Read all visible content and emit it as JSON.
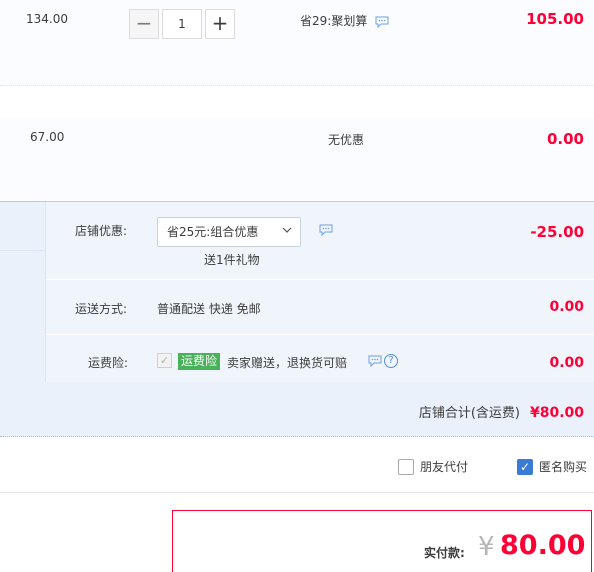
{
  "items": [
    {
      "unit_price": "134.00",
      "quantity": "1",
      "promo": "省29:聚划算",
      "subtotal": "105.00"
    },
    {
      "unit_price": "67.00",
      "promo": "无优惠",
      "subtotal": "0.00"
    }
  ],
  "stepper": {
    "minus": "−",
    "plus": "+"
  },
  "shop": {
    "coupon_label": "店铺优惠:",
    "coupon_selected": "省25元:组合优惠",
    "gift_text": "送1件礼物",
    "coupon_amount": "-25.00",
    "shipping_label": "运送方式:",
    "shipping_text": "普通配送 快递 免邮",
    "shipping_amount": "0.00",
    "insurance_label": "运费险:",
    "insurance_badge": "运费险",
    "insurance_text": "卖家赠送，退换货可赔",
    "insurance_amount": "0.00",
    "total_label": "店铺合计(含运费)",
    "total_value": "¥80.00"
  },
  "options": {
    "friend_pay_label": "朋友代付",
    "friend_pay_checked": false,
    "anonymous_label": "匿名购买",
    "anonymous_checked": true
  },
  "payment": {
    "label": "实付款:",
    "currency": "¥",
    "amount": "80.00"
  },
  "colors": {
    "price_red": "#ff0036",
    "panel_bg": "#eaf1fb",
    "badge_green": "#48b25a",
    "check_blue": "#3a7bd5"
  },
  "icons": {
    "bubble": "speech-bubble-icon",
    "help": "question-icon",
    "chevron": "chevron-down-icon",
    "check": "checkmark-icon"
  }
}
